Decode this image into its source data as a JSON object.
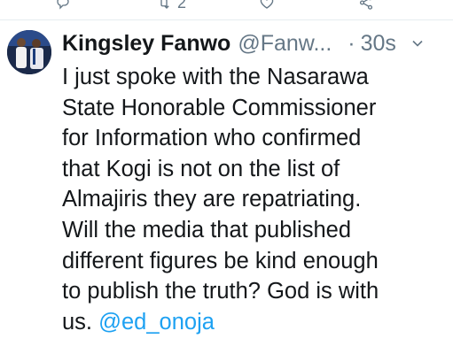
{
  "previous_tweet_actions": {
    "retweet_count": "2",
    "icons": [
      "reply-icon",
      "retweet-icon",
      "like-icon",
      "share-icon"
    ]
  },
  "tweet": {
    "author_name": "Kingsley Fanwo",
    "author_handle": "@Fanw...",
    "separator": "·",
    "time": "30s",
    "text_lines": [
      "I just spoke with the Nasarawa",
      "State Honorable Commissioner",
      "for Information who confirmed",
      "that Kogi is not on the list of",
      "Almajiris they are repatriating.",
      "Will the media that published",
      "different figures be kind enough",
      "to publish the truth? God is with"
    ],
    "last_line_prefix": "us. ",
    "mention": "@ed_onoja"
  },
  "colors": {
    "text": "#14171a",
    "secondary": "#657786",
    "link": "#1da1f2",
    "divider": "#e6ecf0"
  }
}
